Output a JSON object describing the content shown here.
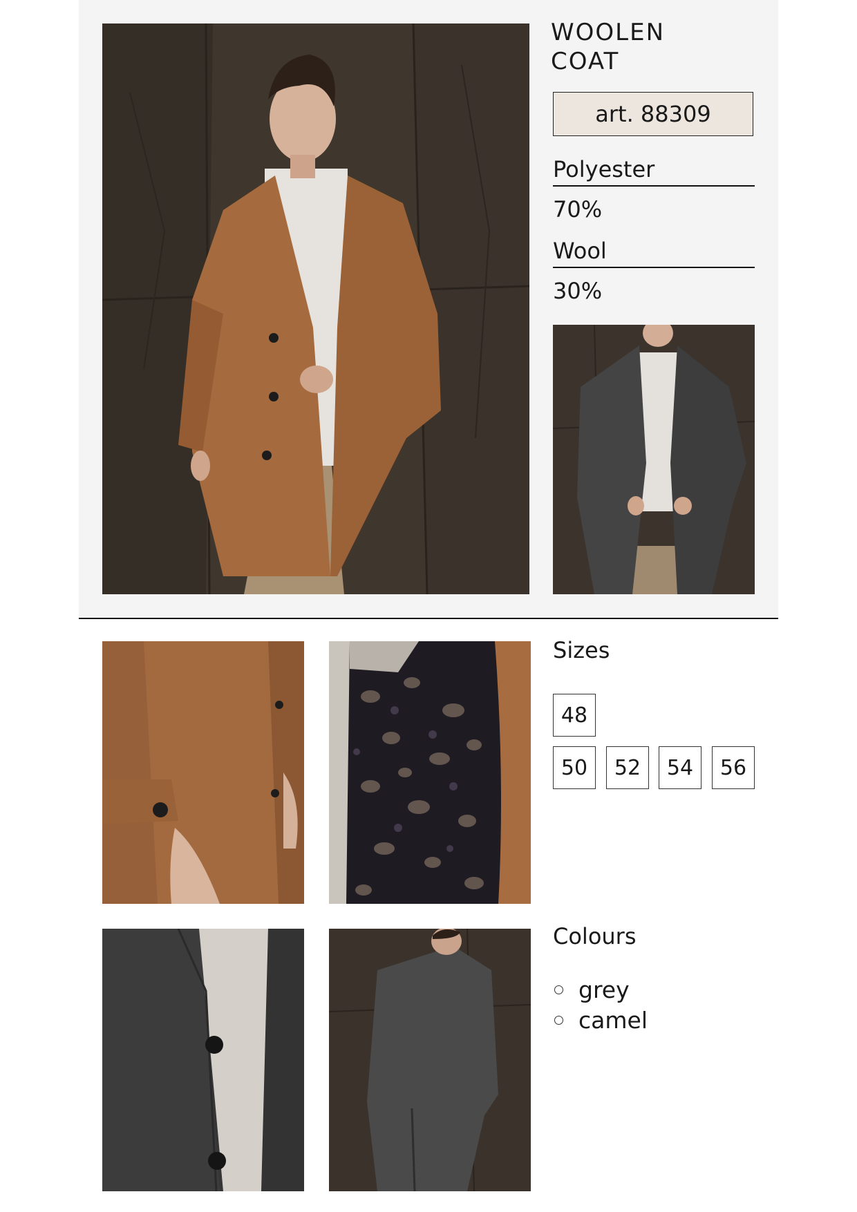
{
  "product": {
    "title_line1": "WOOLEN",
    "title_line2": "COAT",
    "article": "art. 88309"
  },
  "materials": [
    {
      "name": "Polyester",
      "percent": "70%"
    },
    {
      "name": "Wool",
      "percent": "30%"
    }
  ],
  "sizes": {
    "label": "Sizes",
    "options": [
      "48",
      "50",
      "52",
      "54",
      "56"
    ]
  },
  "colours": {
    "label": "Colours",
    "options": [
      "grey",
      "camel"
    ]
  },
  "palette": {
    "panel_bg": "#f4f4f4",
    "article_bg": "#ede6de",
    "camel": "#a5683d",
    "grey": "#3e3e3e",
    "wall": "#3b332c"
  }
}
